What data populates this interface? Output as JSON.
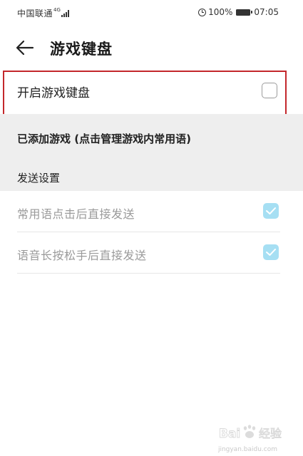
{
  "status_bar": {
    "carrier": "中国联通",
    "network_type": "4G",
    "battery_percent": "100%",
    "time": "07:05",
    "icons": [
      "signal-icon",
      "alarm-icon",
      "battery-icon"
    ]
  },
  "header": {
    "title": "游戏键盘",
    "back_icon": "back-arrow-icon"
  },
  "main_toggle": {
    "label": "开启游戏键盘",
    "checked": false,
    "highlight_color": "#c3272b"
  },
  "added_games": {
    "text": "已添加游戏 (点击管理游戏内常用语)"
  },
  "send_settings": {
    "header": "发送设置",
    "items": [
      {
        "label": "常用语点击后直接发送",
        "checked": true
      },
      {
        "label": "语音长按松手后直接发送",
        "checked": true
      }
    ]
  },
  "colors": {
    "checkbox_checked": "#a6dff3",
    "section_background": "#eeeeee",
    "disabled_text": "#9a9a9a"
  },
  "watermark": {
    "brand": "Bai经验",
    "url": "jingyan.baidu.com"
  }
}
